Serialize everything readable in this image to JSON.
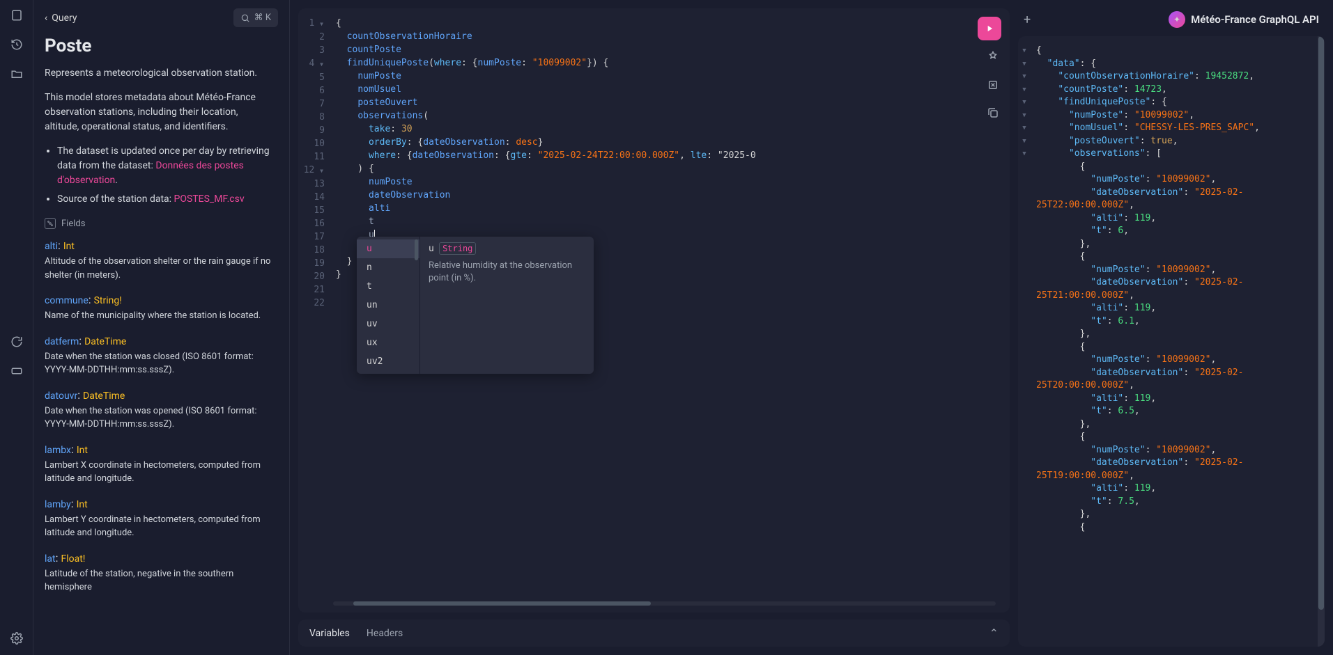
{
  "breadcrumb": {
    "label": "Query"
  },
  "search": {
    "shortcut": "⌘ K"
  },
  "doc": {
    "title": "Poste",
    "summary": "Represents a meteorological observation station.",
    "detail": "This model stores metadata about Météo-France observation stations, including their location,\naltitude, operational status, and identifiers.",
    "bullets": [
      {
        "prefix": "The dataset is updated once per day by retrieving data from the dataset: ",
        "link": "Données des postes d'observation",
        "suffix": "."
      },
      {
        "prefix": "Source of the station data: ",
        "link": "POSTES_MF.csv",
        "suffix": ""
      }
    ],
    "fieldsLabel": "Fields",
    "fields": [
      {
        "name": "alti",
        "type": "Int",
        "desc": "Altitude of the observation shelter or the rain gauge if no shelter (in meters)."
      },
      {
        "name": "commune",
        "type": "String!",
        "desc": "Name of the municipality where the station is located."
      },
      {
        "name": "datferm",
        "type": "DateTime",
        "desc": "Date when the station was closed (ISO 8601 format: YYYY-MM-DDTHH:mm:ss.sssZ)."
      },
      {
        "name": "datouvr",
        "type": "DateTime",
        "desc": "Date when the station was opened (ISO 8601 format: YYYY-MM-DDTHH:mm:ss.sssZ)."
      },
      {
        "name": "lambx",
        "type": "Int",
        "desc": "Lambert X coordinate in hectometers, computed from latitude and longitude."
      },
      {
        "name": "lamby",
        "type": "Int",
        "desc": "Lambert Y coordinate in hectometers, computed from latitude and longitude."
      },
      {
        "name": "lat",
        "type": "Float!",
        "desc": "Latitude of the station, negative in the southern hemisphere"
      }
    ]
  },
  "query": {
    "lines": [
      "{",
      "  countObservationHoraire",
      "  countPoste",
      "  findUniquePoste(where: {numPoste: \"10099002\"}) {",
      "    numPoste",
      "    nomUsuel",
      "    posteOuvert",
      "    observations(",
      "      take: 30",
      "      orderBy: {dateObservation: desc}",
      "      where: {dateObservation: {gte: \"2025-02-24T22:00:00.000Z\", lte: \"2025-0",
      "    ) {",
      "      numPoste",
      "      dateObservation",
      "      alti",
      "      t",
      "      u",
      "    }",
      "  }",
      "}",
      "",
      ""
    ]
  },
  "autocomplete": {
    "items": [
      "u",
      "n",
      "t",
      "un",
      "uv",
      "ux",
      "uv2"
    ],
    "active": "u",
    "docField": "u",
    "docType": "String",
    "docDesc": "Relative humidity at the observation point (in %)."
  },
  "tabs": {
    "variables": "Variables",
    "headers": "Headers"
  },
  "header": {
    "title": "Météo-France GraphQL API"
  },
  "response": {
    "data_label": "data",
    "countObservationHoraire": 19452872,
    "countPoste": 14723,
    "findUniquePoste": {
      "numPoste": "10099002",
      "nomUsuel": "CHESSY-LES-PRES_SAPC",
      "posteOuvert": true,
      "observations": [
        {
          "numPoste": "10099002",
          "dateObservation": "2025-02-25T22:00:00.000Z",
          "alti": 119,
          "t": 6
        },
        {
          "numPoste": "10099002",
          "dateObservation": "2025-02-25T21:00:00.000Z",
          "alti": 119,
          "t": 6.1
        },
        {
          "numPoste": "10099002",
          "dateObservation": "2025-02-25T20:00:00.000Z",
          "alti": 119,
          "t": 6.5
        },
        {
          "numPoste": "10099002",
          "dateObservation": "2025-02-25T19:00:00.000Z",
          "alti": 119,
          "t": 7.5
        }
      ]
    }
  }
}
